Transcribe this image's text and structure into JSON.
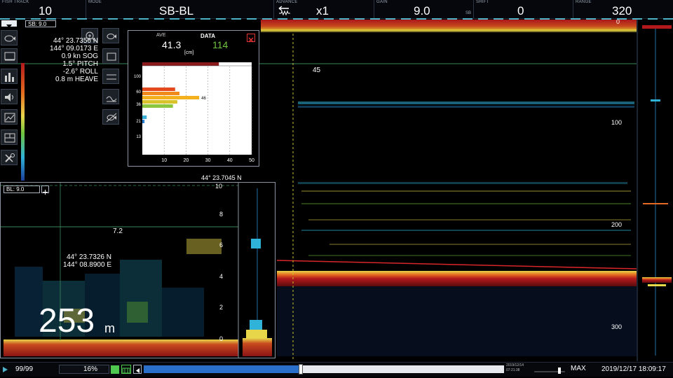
{
  "topbar": {
    "fish_track": {
      "label": "FISH TRACK",
      "value": "10"
    },
    "mode": {
      "label": "MODE",
      "value": "SB-BL"
    },
    "advance": {
      "label": "ADVANCE",
      "value": "x1"
    },
    "gain": {
      "label": "GAIN",
      "value": "9.0",
      "sub": "SB"
    },
    "shift": {
      "label": "SHIFT",
      "value": "0"
    },
    "range": {
      "label": "RANGE",
      "value": "320"
    }
  },
  "sb_badge": "SB: 9.0",
  "nav_info": {
    "lat": "44° 23.7356 N",
    "lon": "144° 09.0173 E",
    "sog": "0.9 kn SOG",
    "pitch": "1.5° PITCH",
    "roll": "-2.6° ROLL",
    "heave": "0.8 m HEAVE"
  },
  "marker_depth": "45",
  "cursor_lat": "44° 23.7045 N",
  "depth_scale": [
    "0",
    "100",
    "200",
    "300"
  ],
  "histogram": {
    "ave_label": "AVE",
    "data_label": "DATA",
    "ave_value": "41.3",
    "unit": "[cm]",
    "data_value": "114",
    "y_ticks": [
      "100",
      "60",
      "36",
      "21",
      "13"
    ],
    "x_ticks": [
      "10",
      "20",
      "30",
      "40",
      "50"
    ],
    "bar_peak_label": "46",
    "bars": [
      {
        "value": 15,
        "color": "#e34a1e"
      },
      {
        "value": 17,
        "color": "#f08a1c"
      },
      {
        "value": 26,
        "color": "#f3b11d"
      },
      {
        "value": 16,
        "color": "#d9c22a"
      },
      {
        "value": 14,
        "color": "#8cc63e"
      },
      {
        "value": 2,
        "color": "#3ab0d8"
      },
      {
        "value": 1,
        "color": "#2a7fd4"
      }
    ]
  },
  "zoom_panel": {
    "bl_label": "BL: 9.0",
    "scale": [
      "10",
      "8",
      "6",
      "4",
      "2",
      "0"
    ],
    "marker": "7.2",
    "lat": "44° 23.7326 N",
    "lon": "144° 08.8900 E",
    "depth_value": "253",
    "depth_unit": "m"
  },
  "statusbar": {
    "page": "99/99",
    "percent": "16%",
    "timeline_label_top": "2019/12/14",
    "timeline_label_bottom": "07:21:38",
    "max_label": "MAX",
    "datetime": "2019/12/17 18:09:17",
    "timeline_progress": 0.4
  },
  "colors": {
    "accent": "#4fb3c8",
    "timeline": "#2a6fc9",
    "seabed": "#c1272d"
  }
}
